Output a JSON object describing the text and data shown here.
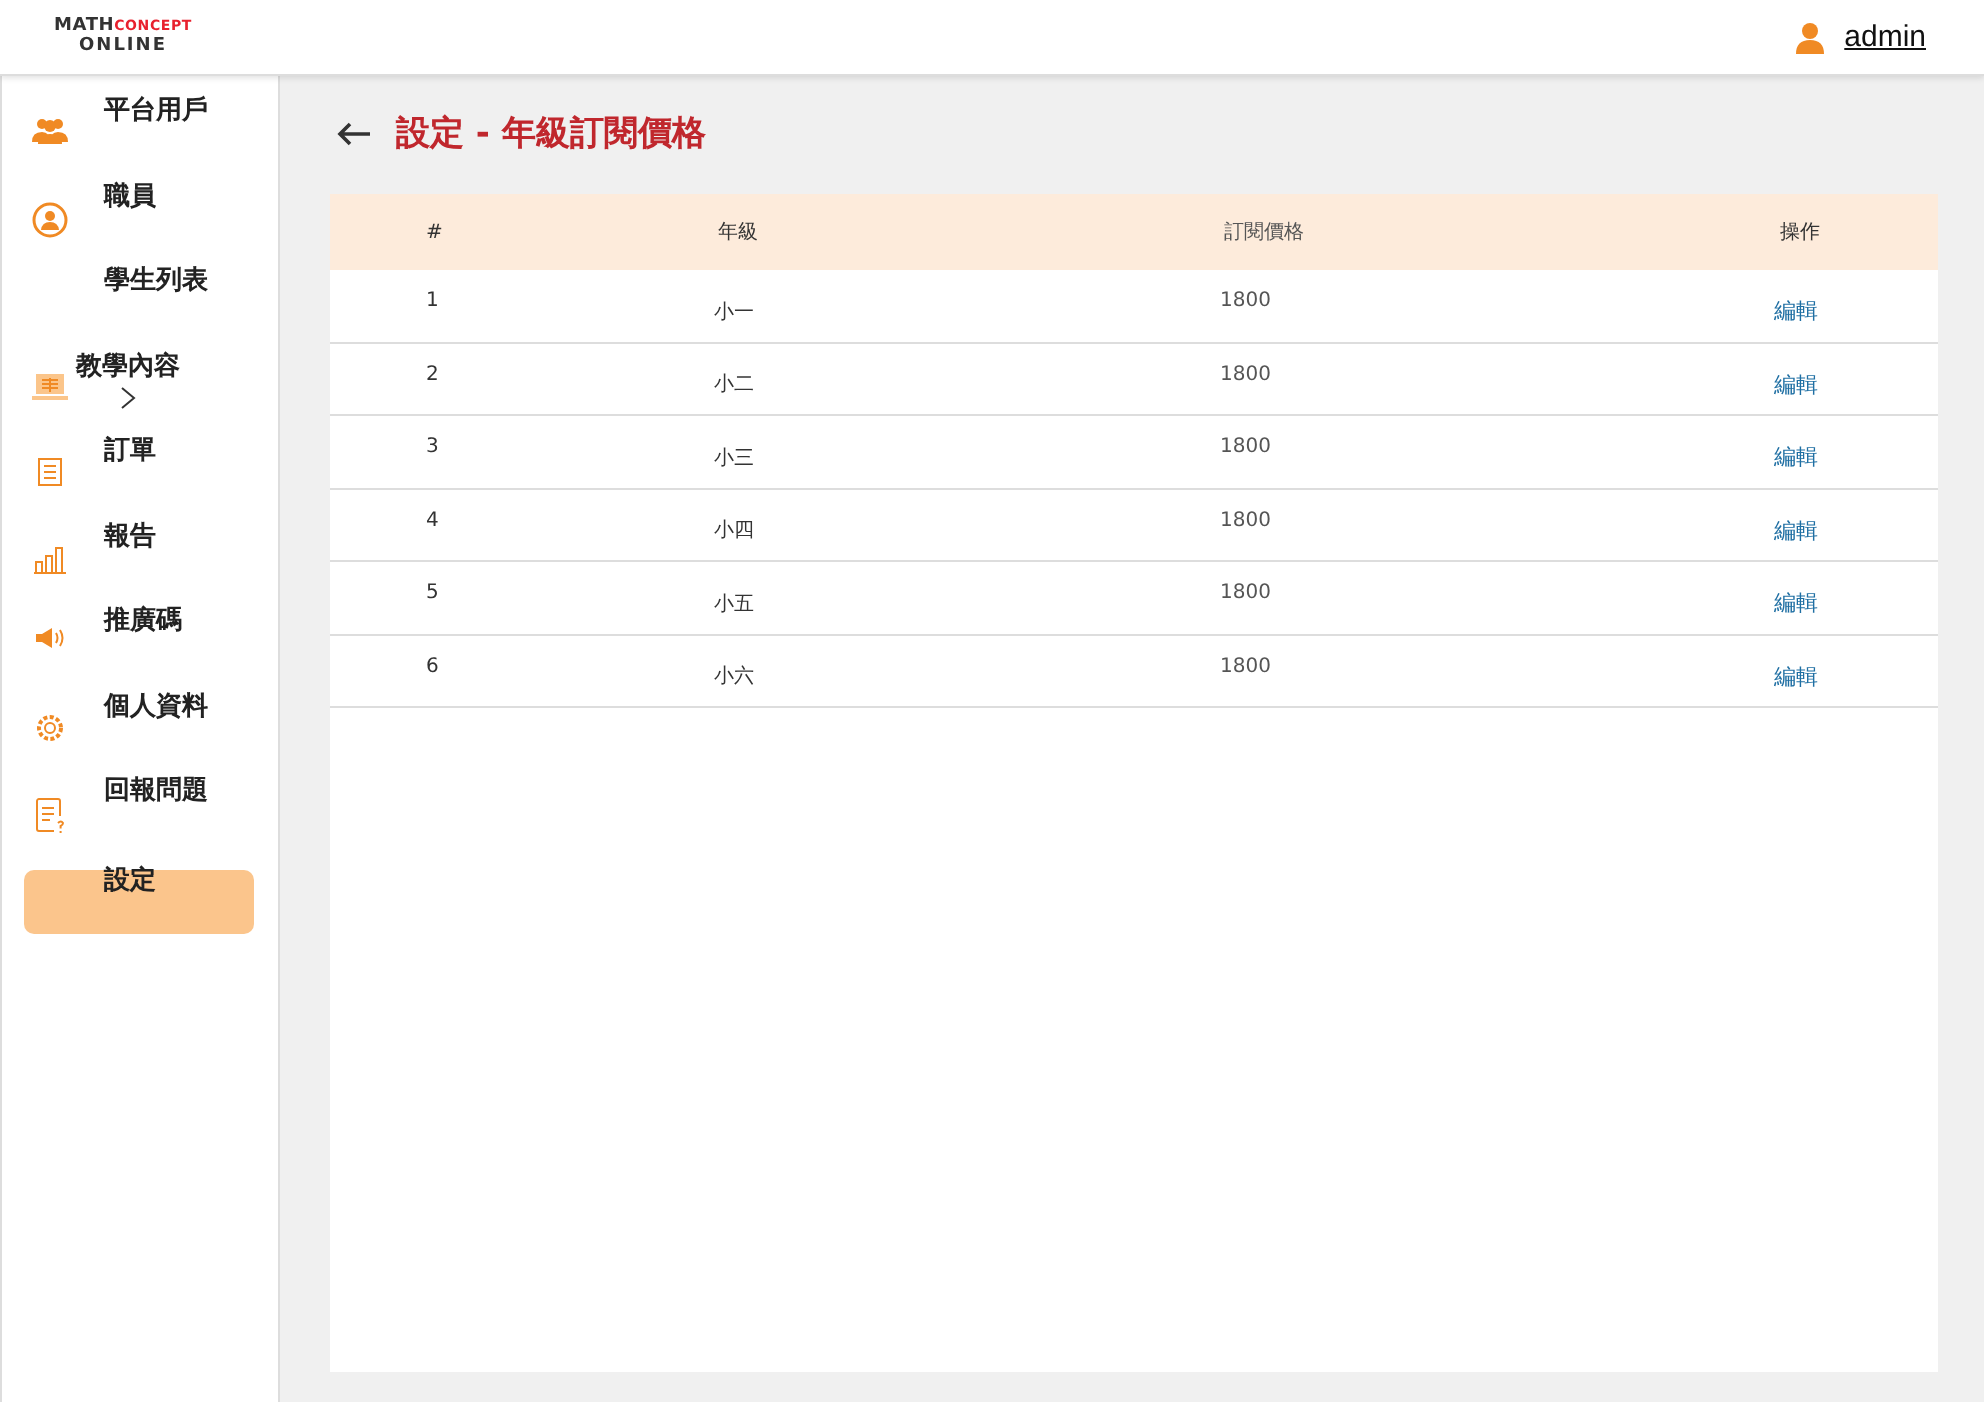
{
  "logo": {
    "part1": "MATH",
    "part2": "CONCEPT",
    "part3": "ONLINE"
  },
  "user": {
    "name": "admin"
  },
  "sidebar": {
    "items": [
      {
        "label": "平台用戶",
        "kind": "people",
        "selected": false
      },
      {
        "label": "職員",
        "kind": "person",
        "selected": false
      },
      {
        "label": "學生列表",
        "kind": "plain",
        "selected": false
      },
      {
        "label": "教學內容",
        "kind": "monitor",
        "selected": false,
        "expanded": false
      },
      {
        "label": "訂單",
        "kind": "document",
        "selected": false
      },
      {
        "label": "報告",
        "kind": "chart",
        "selected": false
      },
      {
        "label": "推廣碼",
        "kind": "speaker",
        "selected": false
      },
      {
        "label": "個人資料",
        "kind": "gear",
        "selected": false
      },
      {
        "label": "回報問題",
        "kind": "report",
        "selected": false
      },
      {
        "label": "設定",
        "kind": "plain",
        "selected": true
      }
    ]
  },
  "page": {
    "title": "設定 - 年級訂閱價格"
  },
  "table": {
    "columns": [
      "#",
      "年級",
      "訂閱價格",
      "操作"
    ],
    "rows": [
      {
        "index": "1",
        "grade": "小一",
        "price": "1800",
        "action": "編輯"
      },
      {
        "index": "2",
        "grade": "小二",
        "price": "1800",
        "action": "編輯"
      },
      {
        "index": "3",
        "grade": "小三",
        "price": "1800",
        "action": "編輯"
      },
      {
        "index": "4",
        "grade": "小四",
        "price": "1800",
        "action": "編輯"
      },
      {
        "index": "5",
        "grade": "小五",
        "price": "1800",
        "action": "編輯"
      },
      {
        "index": "6",
        "grade": "小六",
        "price": "1800",
        "action": "編輯"
      }
    ]
  }
}
